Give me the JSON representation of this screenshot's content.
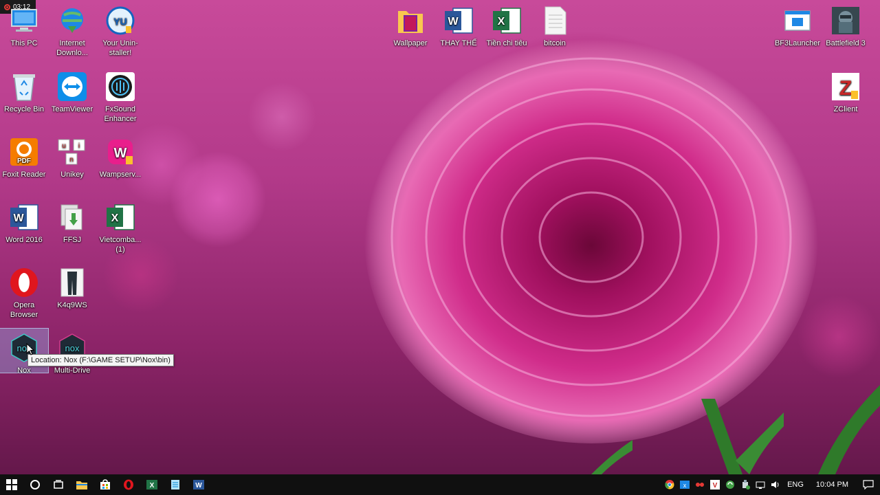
{
  "recording": {
    "time": "03:12"
  },
  "desktop_icons": {
    "this_pc": {
      "label": "This PC",
      "icon": "computer-icon"
    },
    "internet_download": {
      "label": "Internet Downlo...",
      "icon": "idm-globe-icon"
    },
    "your_uninstaller": {
      "label": "Your Unin-staller!",
      "icon": "uninstaller-icon"
    },
    "recycle_bin": {
      "label": "Recycle Bin",
      "icon": "recycle-bin-icon"
    },
    "teamviewer": {
      "label": "TeamViewer",
      "icon": "teamviewer-icon"
    },
    "fxsound": {
      "label": "FxSound Enhancer",
      "icon": "fxsound-icon"
    },
    "foxit_reader": {
      "label": "Foxit Reader",
      "icon": "foxit-pdf-icon"
    },
    "unikey": {
      "label": "Unikey",
      "icon": "unikey-icon"
    },
    "wampserver": {
      "label": "Wampserv...",
      "icon": "wampserver-icon"
    },
    "word_2016": {
      "label": "Word 2016",
      "icon": "word-icon"
    },
    "ffsj": {
      "label": "FFSJ",
      "icon": "ffsj-icon"
    },
    "vietcombank": {
      "label": "Vietcomba... (1)",
      "icon": "excel-file-icon"
    },
    "opera": {
      "label": "Opera Browser",
      "icon": "opera-icon"
    },
    "k4q9ws": {
      "label": "K4q9WS",
      "icon": "image-file-icon"
    },
    "nox": {
      "label": "Nox",
      "icon": "nox-icon"
    },
    "multi_drive": {
      "label": "Multi-Drive",
      "icon": "nox-multi-drive-icon"
    },
    "wallpaper": {
      "label": "Wallpaper",
      "icon": "folder-icon"
    },
    "thay_the": {
      "label": "THAY THẾ",
      "icon": "word-file-icon"
    },
    "tien_chi_tieu": {
      "label": "Tiền chi tiêu",
      "icon": "excel-file-icon"
    },
    "bitcoin": {
      "label": "bitcoin",
      "icon": "text-file-icon"
    },
    "bf3launcher": {
      "label": "BF3Launcher",
      "icon": "bf3-launcher-icon"
    },
    "battlefield3": {
      "label": "Battlefield 3",
      "icon": "battlefield-icon"
    },
    "zclient": {
      "label": "ZClient",
      "icon": "zclient-icon"
    }
  },
  "tooltip": {
    "text": "Location: Nox (F:\\GAME SETUP\\Nox\\bin)"
  },
  "taskbar": {
    "pinned": [
      "start-icon",
      "cortana-icon",
      "task-view-icon",
      "file-explorer-icon",
      "store-icon",
      "opera-icon",
      "excel-icon",
      "notepad-icon",
      "word-icon"
    ],
    "tray_icons": [
      "chrome-icon",
      "excel-tray-icon",
      "network-app-icon",
      "vietkey-icon",
      "sync-icon",
      "usb-icon",
      "wifi-icon",
      "volume-icon"
    ],
    "language": "ENG",
    "clock": "10:04 PM"
  },
  "colors": {
    "taskbar": "#101010",
    "wallpaper_accent": "#c2187a"
  }
}
